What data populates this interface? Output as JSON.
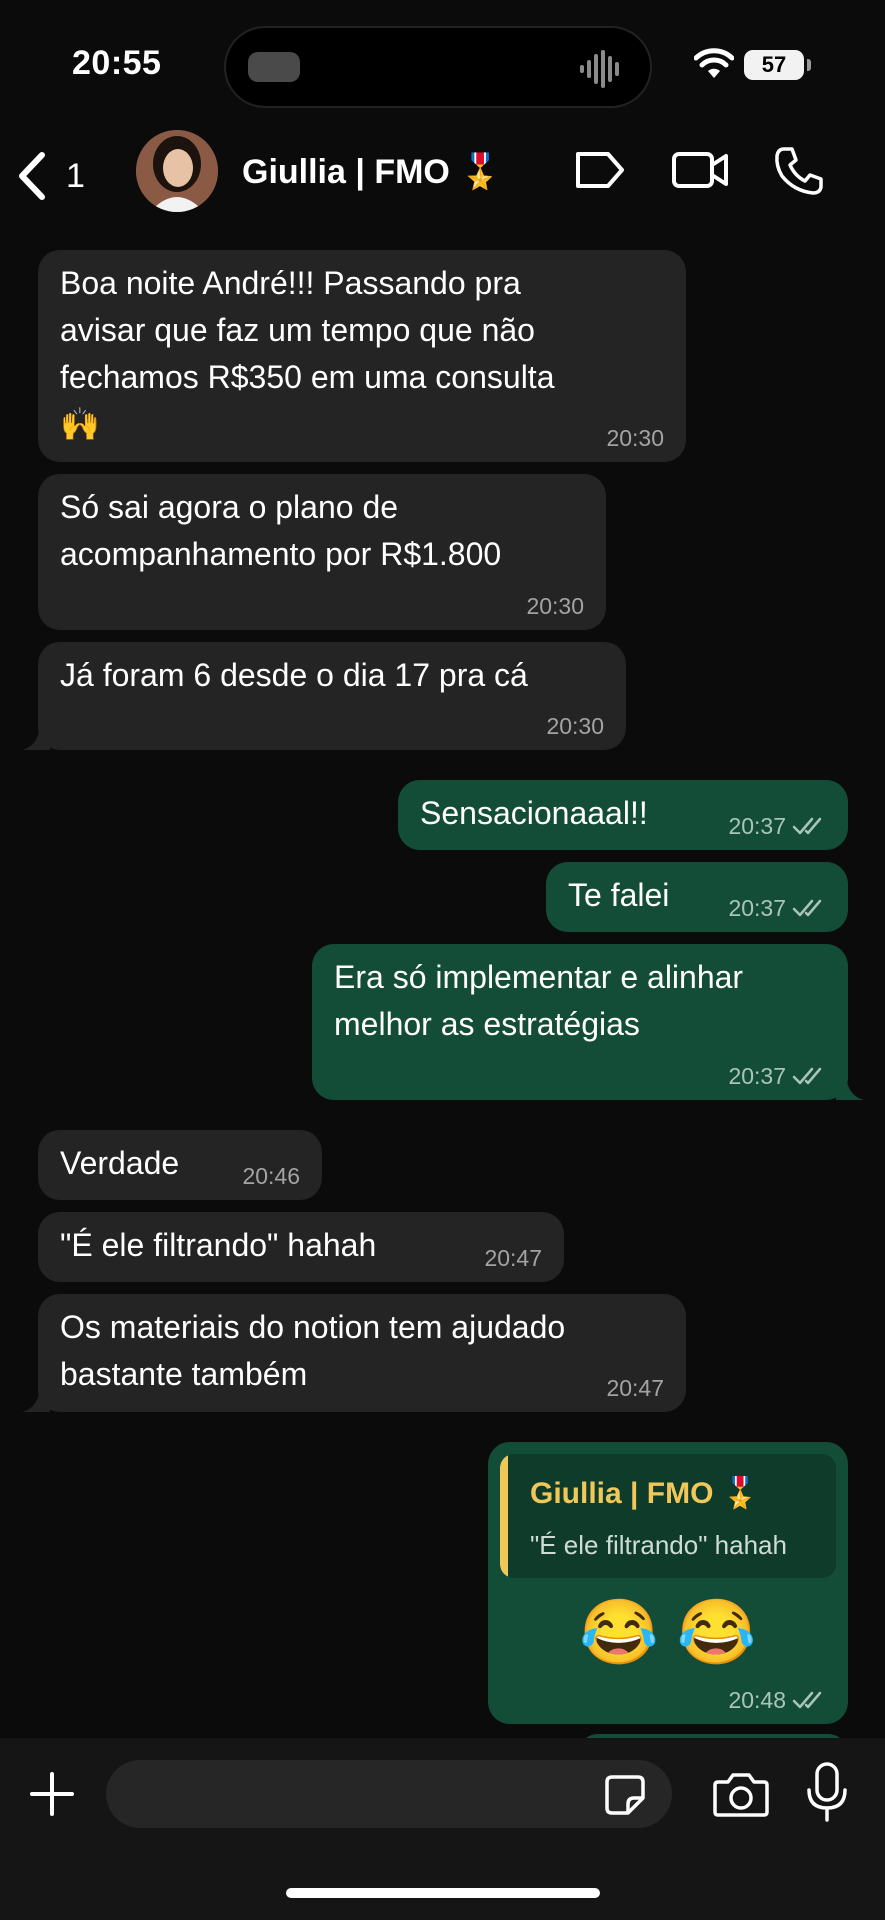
{
  "status_bar": {
    "time": "20:55",
    "battery": "57"
  },
  "header": {
    "back_count": "1",
    "contact_name": "Giullia | FMO 🎖️"
  },
  "messages": [
    {
      "dir": "in",
      "text": "Boa noite André!!! Passando pra\navisar que faz um tempo que não\nfechamos R$350 em uma consulta\n🙌",
      "time": "20:30"
    },
    {
      "dir": "in",
      "text": "Só sai agora o plano de\nacompanhamento por R$1.800",
      "time": "20:30"
    },
    {
      "dir": "in",
      "text": "Já foram 6 desde o dia 17 pra cá",
      "time": "20:30"
    },
    {
      "dir": "out",
      "text": "Sensacionaaal!!",
      "time": "20:37"
    },
    {
      "dir": "out",
      "text": "Te falei",
      "time": "20:37"
    },
    {
      "dir": "out",
      "text": "Era só implementar e alinhar\nmelhor as estratégias",
      "time": "20:37"
    },
    {
      "dir": "in",
      "text": "Verdade",
      "time": "20:46"
    },
    {
      "dir": "in",
      "text": "\"É ele filtrando\" hahah",
      "time": "20:47"
    },
    {
      "dir": "in",
      "text": "Os materiais do notion tem ajudado\nbastante também",
      "time": "20:47"
    },
    {
      "dir": "out",
      "reply_to_name": "Giullia | FMO 🎖️",
      "reply_to_text": "\"É ele filtrando\" hahah",
      "text": "😂 😂",
      "time": "20:48"
    }
  ],
  "input": {
    "placeholder": ""
  },
  "colors": {
    "incoming": "#242424",
    "outgoing": "#144d37",
    "quote_accent": "#f0c85a"
  }
}
